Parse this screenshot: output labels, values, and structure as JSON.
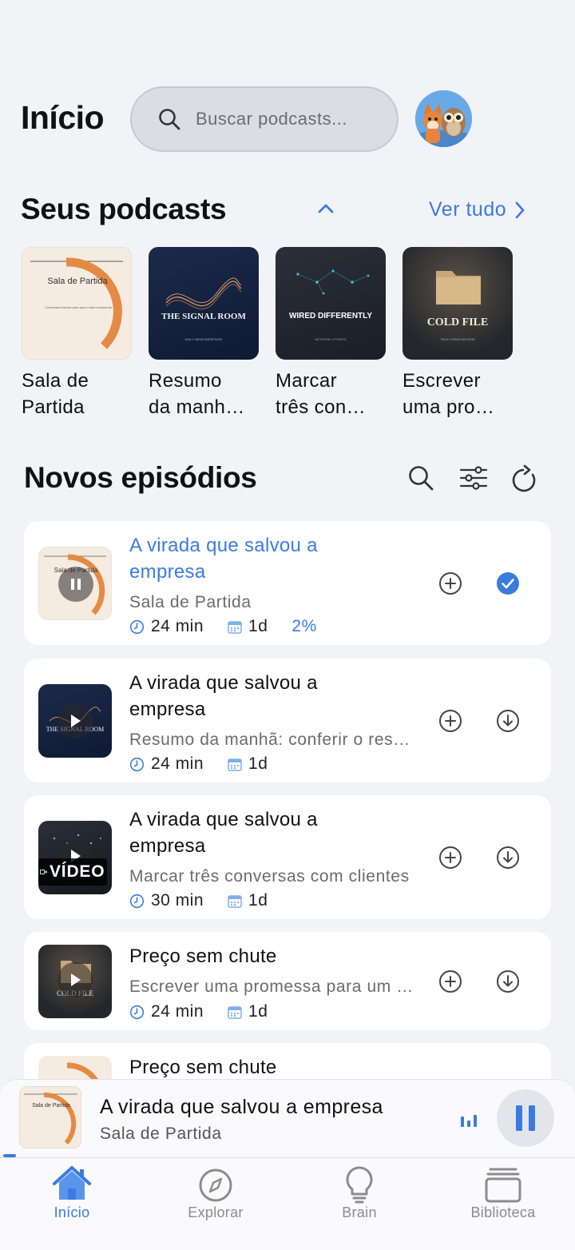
{
  "header": {
    "title": "Início",
    "search_placeholder": "Buscar podcasts..."
  },
  "your_podcasts": {
    "title": "Seus podcasts",
    "see_all": "Ver tudo",
    "items": [
      {
        "label": "Sala de\nPartida",
        "cover_text": "Sala de Partida",
        "cover_tagline": "Conversas francas para quem está começando"
      },
      {
        "label": "Resumo\nda manh…",
        "cover_text": "THE SIGNAL ROOM",
        "cover_tagline": "DAILY NEWS BRIEFINGS"
      },
      {
        "label": "Marcar\ntrês con…",
        "cover_text": "WIRED DIFFERENTLY",
        "cover_tagline": "NETWORK STORIES"
      },
      {
        "label": "Escrever\numa pro…",
        "cover_text": "COLD FILE",
        "cover_tagline": "TRUE CRIME ARCHIVE"
      }
    ]
  },
  "new_episodes": {
    "title": "Novos episódios",
    "items": [
      {
        "title": "A virada que salvou a empresa",
        "subtitle": "Sala de Partida",
        "duration": "24 min",
        "age": "1d",
        "progress": "2%",
        "active": true,
        "badge": ""
      },
      {
        "title": "A virada que salvou a empresa",
        "subtitle": "Resumo da manhã: conferir o resumo de hoje",
        "duration": "24 min",
        "age": "1d",
        "progress": "",
        "active": false,
        "badge": ""
      },
      {
        "title": "A virada que salvou a empresa",
        "subtitle": "Marcar três conversas com clientes",
        "duration": "30 min",
        "age": "1d",
        "progress": "",
        "active": false,
        "badge": "VÍDEO"
      },
      {
        "title": "Preço sem chute",
        "subtitle": "Escrever uma promessa para um cliente",
        "duration": "24 min",
        "age": "1d",
        "progress": "",
        "active": false,
        "badge": ""
      },
      {
        "title": "Preço sem chute",
        "subtitle": "",
        "duration": "",
        "age": "",
        "progress": "",
        "active": false,
        "badge": ""
      }
    ]
  },
  "mini_player": {
    "title": "A virada que salvou a empresa",
    "subtitle": "Sala de Partida",
    "playback_progress": 0.02
  },
  "tabs": [
    {
      "label": "Início",
      "active": true
    },
    {
      "label": "Explorar",
      "active": false
    },
    {
      "label": "Brain",
      "active": false
    },
    {
      "label": "Biblioteca",
      "active": false
    }
  ],
  "colors": {
    "accent": "#3b7be0",
    "background": "#f2f3f7"
  }
}
